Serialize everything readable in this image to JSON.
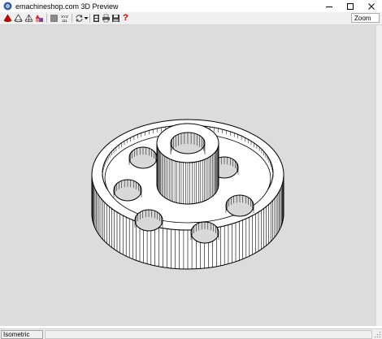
{
  "window": {
    "title": "emachineshop.com 3D Preview",
    "controls": [
      "minimize-icon",
      "maximize-icon",
      "close-icon"
    ]
  },
  "toolbar": {
    "buttons": [
      {
        "name": "solid-view-button",
        "icon": "red-cone-icon"
      },
      {
        "name": "shaded-view-button",
        "icon": "outline-cone-icon"
      },
      {
        "name": "wireframe-view-button",
        "icon": "wire-cone-icon"
      },
      {
        "name": "multicolor-view-button",
        "icon": "colored-shapes-icon"
      },
      {
        "name": "solid-color-button",
        "icon": "gray-square-icon"
      },
      {
        "name": "coordinates-button",
        "icon": "xyz-icon",
        "label": "XYZ"
      },
      {
        "name": "rotate-button",
        "icon": "rotate-arrows-icon"
      },
      {
        "name": "film-button",
        "icon": "film-icon"
      },
      {
        "name": "print-button",
        "icon": "printer-icon"
      },
      {
        "name": "save-button",
        "icon": "floppy-icon"
      },
      {
        "name": "help-button",
        "icon": "question-mark-icon",
        "label": "?"
      }
    ],
    "zoom": {
      "selected": "Zoom"
    }
  },
  "status": {
    "view_mode": "Isometric"
  },
  "colors": {
    "viewport_bg": "#dcdcdc",
    "chrome_bg": "#f0f0f0",
    "accent_red": "#cc0000"
  }
}
